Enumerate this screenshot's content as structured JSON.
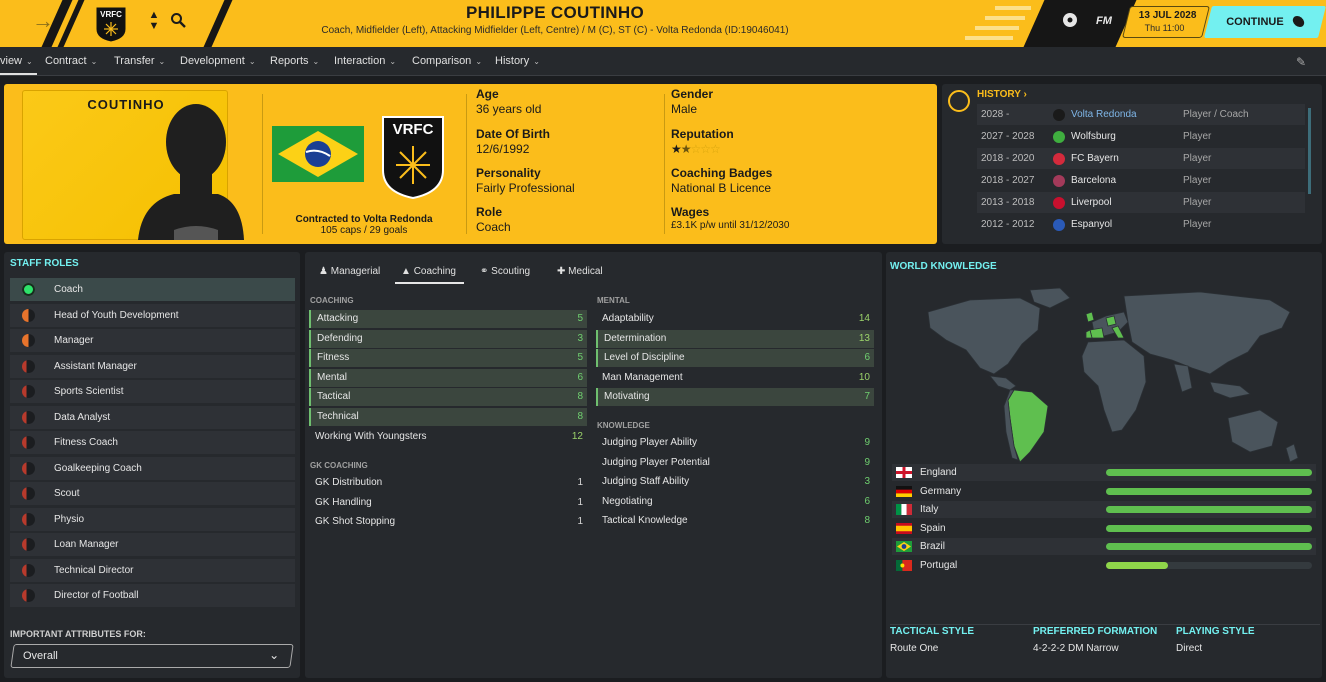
{
  "header": {
    "name": "PHILIPPE COUTINHO",
    "subtitle": "Coach, Midfielder (Left), Attacking Midfielder (Left, Centre) / M (C), ST (C) - Volta Redonda (ID:19046041)",
    "crest_text": "VRFC",
    "fm_label": "FM",
    "date": "13 JUL 2028",
    "time": "Thu 11:00",
    "continue_label": "CONTINUE"
  },
  "nav": {
    "items": [
      "view",
      "Contract",
      "Transfer",
      "Development",
      "Reports",
      "Interaction",
      "Comparison",
      "History"
    ]
  },
  "profile": {
    "portrait_name": "COUTINHO",
    "club_badge": "VRFC",
    "contract_line": "Contracted to Volta Redonda",
    "caps_line": "105 caps / 29 goals",
    "age_label": "Age",
    "age": "36 years old",
    "dob_label": "Date Of Birth",
    "dob": "12/6/1992",
    "personality_label": "Personality",
    "personality": "Fairly Professional",
    "role_label": "Role",
    "role": "Coach",
    "gender_label": "Gender",
    "gender": "Male",
    "reputation_label": "Reputation",
    "reputation_stars": 1.5,
    "badges_label": "Coaching Badges",
    "badges": "National B Licence",
    "wages_label": "Wages",
    "wages": "£3.1K p/w until 31/12/2030"
  },
  "history": {
    "title": "HISTORY",
    "rows": [
      {
        "years": "2028 -",
        "club": "Volta Redonda",
        "role": "Player / Coach",
        "color": "#1a1a1a"
      },
      {
        "years": "2027 - 2028",
        "club": "Wolfsburg",
        "role": "Player",
        "color": "#3fae3f"
      },
      {
        "years": "2018 - 2020",
        "club": "FC Bayern",
        "role": "Player",
        "color": "#d42a3c"
      },
      {
        "years": "2018 - 2027",
        "club": "Barcelona",
        "role": "Player",
        "color": "#a33a5a"
      },
      {
        "years": "2013 - 2018",
        "club": "Liverpool",
        "role": "Player",
        "color": "#c8102e"
      },
      {
        "years": "2012 - 2012",
        "club": "Espanyol",
        "role": "Player",
        "color": "#2a5ab8"
      }
    ]
  },
  "staff_roles": {
    "title": "STAFF ROLES",
    "items": [
      {
        "label": "Coach",
        "level": "full"
      },
      {
        "label": "Head of Youth Development",
        "level": "half"
      },
      {
        "label": "Manager",
        "level": "half"
      },
      {
        "label": "Assistant Manager",
        "level": "low"
      },
      {
        "label": "Sports Scientist",
        "level": "low"
      },
      {
        "label": "Data Analyst",
        "level": "low"
      },
      {
        "label": "Fitness Coach",
        "level": "low"
      },
      {
        "label": "Goalkeeping Coach",
        "level": "low"
      },
      {
        "label": "Scout",
        "level": "low"
      },
      {
        "label": "Physio",
        "level": "low"
      },
      {
        "label": "Loan Manager",
        "level": "low"
      },
      {
        "label": "Technical Director",
        "level": "low"
      },
      {
        "label": "Director of Football",
        "level": "low"
      }
    ],
    "important_label": "IMPORTANT ATTRIBUTES FOR:",
    "important_value": "Overall"
  },
  "tabs": [
    "Managerial",
    "Coaching",
    "Scouting",
    "Medical"
  ],
  "coaching": {
    "coaching_title": "COACHING",
    "coaching_attrs": [
      {
        "name": "Attacking",
        "value": "5",
        "hl": true
      },
      {
        "name": "Defending",
        "value": "3",
        "hl": true
      },
      {
        "name": "Fitness",
        "value": "5",
        "hl": true
      },
      {
        "name": "Mental",
        "value": "6",
        "hl": true
      },
      {
        "name": "Tactical",
        "value": "8",
        "hl": true
      },
      {
        "name": "Technical",
        "value": "8",
        "hl": true
      },
      {
        "name": "Working With Youngsters",
        "value": "12",
        "hl": false
      }
    ],
    "gk_title": "GK COACHING",
    "gk_attrs": [
      {
        "name": "GK Distribution",
        "value": "1"
      },
      {
        "name": "GK Handling",
        "value": "1"
      },
      {
        "name": "GK Shot Stopping",
        "value": "1"
      }
    ],
    "mental_title": "MENTAL",
    "mental_attrs": [
      {
        "name": "Adaptability",
        "value": "14",
        "hl": false
      },
      {
        "name": "Determination",
        "value": "13",
        "hl": true
      },
      {
        "name": "Level of Discipline",
        "value": "6",
        "hl": true
      },
      {
        "name": "Man Management",
        "value": "10",
        "hl": false
      },
      {
        "name": "Motivating",
        "value": "7",
        "hl": true
      }
    ],
    "knowledge_title": "KNOWLEDGE",
    "knowledge_attrs": [
      {
        "name": "Judging Player Ability",
        "value": "9"
      },
      {
        "name": "Judging Player Potential",
        "value": "9"
      },
      {
        "name": "Judging Staff Ability",
        "value": "3"
      },
      {
        "name": "Negotiating",
        "value": "6"
      },
      {
        "name": "Tactical Knowledge",
        "value": "8"
      }
    ]
  },
  "world": {
    "title": "WORLD KNOWLEDGE",
    "countries": [
      {
        "name": "England",
        "level": 1.0
      },
      {
        "name": "Germany",
        "level": 1.0
      },
      {
        "name": "Italy",
        "level": 1.0
      },
      {
        "name": "Spain",
        "level": 1.0
      },
      {
        "name": "Brazil",
        "level": 1.0
      },
      {
        "name": "Portugal",
        "level": 0.3
      }
    ],
    "tactical_style_label": "TACTICAL STYLE",
    "tactical_style": "Route One",
    "formation_label": "PREFERRED FORMATION",
    "formation": "4-2-2-2 DM Narrow",
    "playing_style_label": "PLAYING STYLE",
    "playing_style": "Direct"
  }
}
